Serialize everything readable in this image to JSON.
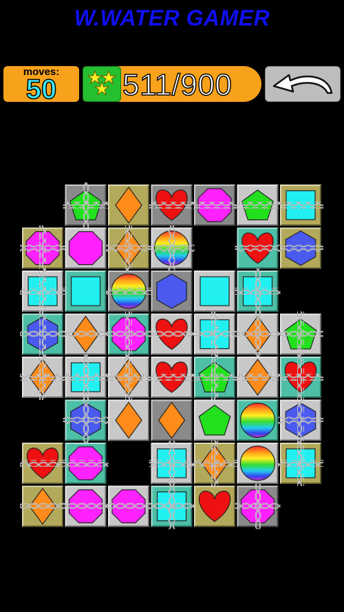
{
  "header": {
    "title": "W.WATER GAMER"
  },
  "hud": {
    "moves_label": "moves:",
    "moves_value": "50",
    "score_value": "511/900",
    "stars_icon": "three-stars-icon",
    "undo_icon": "undo-arrow-icon"
  },
  "colors": {
    "tile_gray": "#8a8a8a",
    "tile_olive": "#b3a95a",
    "tile_teal": "#4cbfa6",
    "tile_silver": "#c8c8c8",
    "pentagon": "#22e01e",
    "diamond": "#ff8c1a",
    "heart": "#ee1111",
    "octagon": "#ff22ff",
    "square": "#22f0f0",
    "hexagon": "#4a5aee"
  },
  "board": {
    "rows": [
      [
        null,
        {
          "bg": "gray",
          "shape": "pentagon",
          "chain": "cross"
        },
        {
          "bg": "olive",
          "shape": "diamond",
          "chain": "none"
        },
        {
          "bg": "gray",
          "shape": "heart",
          "chain": "h"
        },
        {
          "bg": "gray",
          "shape": "octagon",
          "chain": "h"
        },
        {
          "bg": "silver",
          "shape": "pentagon",
          "chain": "h"
        },
        {
          "bg": "olive",
          "shape": "square",
          "chain": "h"
        }
      ],
      [
        {
          "bg": "olive",
          "shape": "octagon",
          "chain": "cross"
        },
        {
          "bg": "silver",
          "shape": "octagon",
          "chain": "none"
        },
        {
          "bg": "olive",
          "shape": "diamond",
          "chain": "cross"
        },
        {
          "bg": "silver",
          "shape": "rainbow",
          "chain": "cross"
        },
        null,
        {
          "bg": "teal",
          "shape": "heart",
          "chain": "h"
        },
        {
          "bg": "olive",
          "shape": "hexagon",
          "chain": "h"
        }
      ],
      [
        {
          "bg": "silver",
          "shape": "square",
          "chain": "cross"
        },
        {
          "bg": "teal",
          "shape": "square",
          "chain": "none"
        },
        {
          "bg": "gray",
          "shape": "rainbow",
          "chain": "h"
        },
        {
          "bg": "gray",
          "shape": "hexagon",
          "chain": "none"
        },
        {
          "bg": "silver",
          "shape": "square",
          "chain": "none"
        },
        {
          "bg": "teal",
          "shape": "square",
          "chain": "cross"
        },
        null
      ],
      [
        {
          "bg": "teal",
          "shape": "hexagon",
          "chain": "cross"
        },
        {
          "bg": "silver",
          "shape": "diamond",
          "chain": "h"
        },
        {
          "bg": "teal",
          "shape": "octagon",
          "chain": "cross"
        },
        {
          "bg": "silver",
          "shape": "heart",
          "chain": "h"
        },
        {
          "bg": "silver",
          "shape": "square",
          "chain": "cross"
        },
        {
          "bg": "silver",
          "shape": "diamond",
          "chain": "cross"
        },
        {
          "bg": "silver",
          "shape": "pentagon",
          "chain": "cross"
        }
      ],
      [
        {
          "bg": "silver",
          "shape": "diamond",
          "chain": "cross"
        },
        {
          "bg": "silver",
          "shape": "square",
          "chain": "cross"
        },
        {
          "bg": "silver",
          "shape": "diamond",
          "chain": "cross"
        },
        {
          "bg": "silver",
          "shape": "heart",
          "chain": "h"
        },
        {
          "bg": "teal",
          "shape": "pentagon",
          "chain": "cross"
        },
        {
          "bg": "silver",
          "shape": "diamond",
          "chain": "h"
        },
        {
          "bg": "teal",
          "shape": "heart",
          "chain": "cross"
        }
      ],
      [
        null,
        {
          "bg": "teal",
          "shape": "hexagon",
          "chain": "cross"
        },
        {
          "bg": "silver",
          "shape": "diamond",
          "chain": "none"
        },
        {
          "bg": "gray",
          "shape": "diamond",
          "chain": "none"
        },
        {
          "bg": "silver",
          "shape": "pentagon",
          "chain": "none"
        },
        {
          "bg": "teal",
          "shape": "rainbow",
          "chain": "none"
        },
        {
          "bg": "silver",
          "shape": "hexagon",
          "chain": "cross"
        }
      ],
      [
        {
          "bg": "olive",
          "shape": "heart",
          "chain": "h"
        },
        {
          "bg": "teal",
          "shape": "octagon",
          "chain": "h"
        },
        null,
        {
          "bg": "silver",
          "shape": "square",
          "chain": "cross"
        },
        {
          "bg": "olive",
          "shape": "diamond",
          "chain": "cross"
        },
        {
          "bg": "silver",
          "shape": "rainbow",
          "chain": "none"
        },
        {
          "bg": "olive",
          "shape": "square",
          "chain": "cross"
        }
      ],
      [
        {
          "bg": "olive",
          "shape": "diamond",
          "chain": "h"
        },
        {
          "bg": "silver",
          "shape": "octagon",
          "chain": "h"
        },
        {
          "bg": "silver",
          "shape": "octagon",
          "chain": "h"
        },
        {
          "bg": "teal",
          "shape": "square",
          "chain": "cross"
        },
        {
          "bg": "olive",
          "shape": "heart",
          "chain": "none"
        },
        {
          "bg": "gray",
          "shape": "octagon",
          "chain": "cross"
        },
        null
      ]
    ]
  }
}
